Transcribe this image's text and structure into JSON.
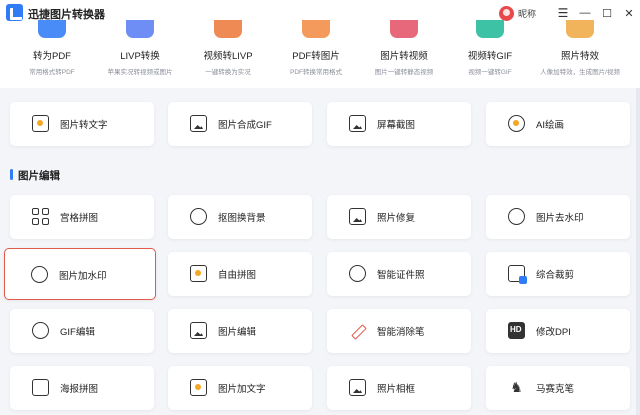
{
  "window": {
    "title": "迅捷图片转换器",
    "nickname": "昵称",
    "menu_glyph": "☰",
    "minimize_glyph": "—",
    "maximize_glyph": "☐",
    "close_glyph": "✕"
  },
  "tools": [
    {
      "label": "转为PDF",
      "desc": "常用格式转PDF",
      "color": "#4a8cf7"
    },
    {
      "label": "LIVP转换",
      "desc": "苹果实况转视频或图片",
      "color": "#6f8ef5"
    },
    {
      "label": "视频转LIVP",
      "desc": "一键转换为实况",
      "color": "#f08a55"
    },
    {
      "label": "PDF转图片",
      "desc": "PDF转换常用格式",
      "color": "#f39a5c"
    },
    {
      "label": "图片转视频",
      "desc": "图片一键转静态视频",
      "color": "#e7677b"
    },
    {
      "label": "视频转GIF",
      "desc": "视频一键转GIF",
      "color": "#3ec2a6"
    },
    {
      "label": "照片特效",
      "desc": "人像加特效，生成图片/视频",
      "color": "#f2b45a"
    }
  ],
  "top_cards": [
    {
      "label": "图片转文字"
    },
    {
      "label": "图片合成GIF"
    },
    {
      "label": "屏幕截图"
    },
    {
      "label": "AI绘画"
    }
  ],
  "section": {
    "title": "图片编辑"
  },
  "edit_cards": [
    {
      "label": "宫格拼图"
    },
    {
      "label": "抠图换背景"
    },
    {
      "label": "照片修复"
    },
    {
      "label": "图片去水印"
    },
    {
      "label": "图片加水印"
    },
    {
      "label": "自由拼图"
    },
    {
      "label": "智能证件照"
    },
    {
      "label": "综合裁剪"
    },
    {
      "label": "GIF编辑"
    },
    {
      "label": "图片编辑"
    },
    {
      "label": "智能消除笔"
    },
    {
      "label": "修改DPI"
    },
    {
      "label": "海报拼图"
    },
    {
      "label": "图片加文字"
    },
    {
      "label": "照片相框"
    },
    {
      "label": "马赛克笔"
    }
  ],
  "colors": {
    "accent": "#2f7cf6",
    "selected_border": "#e05a4a"
  }
}
